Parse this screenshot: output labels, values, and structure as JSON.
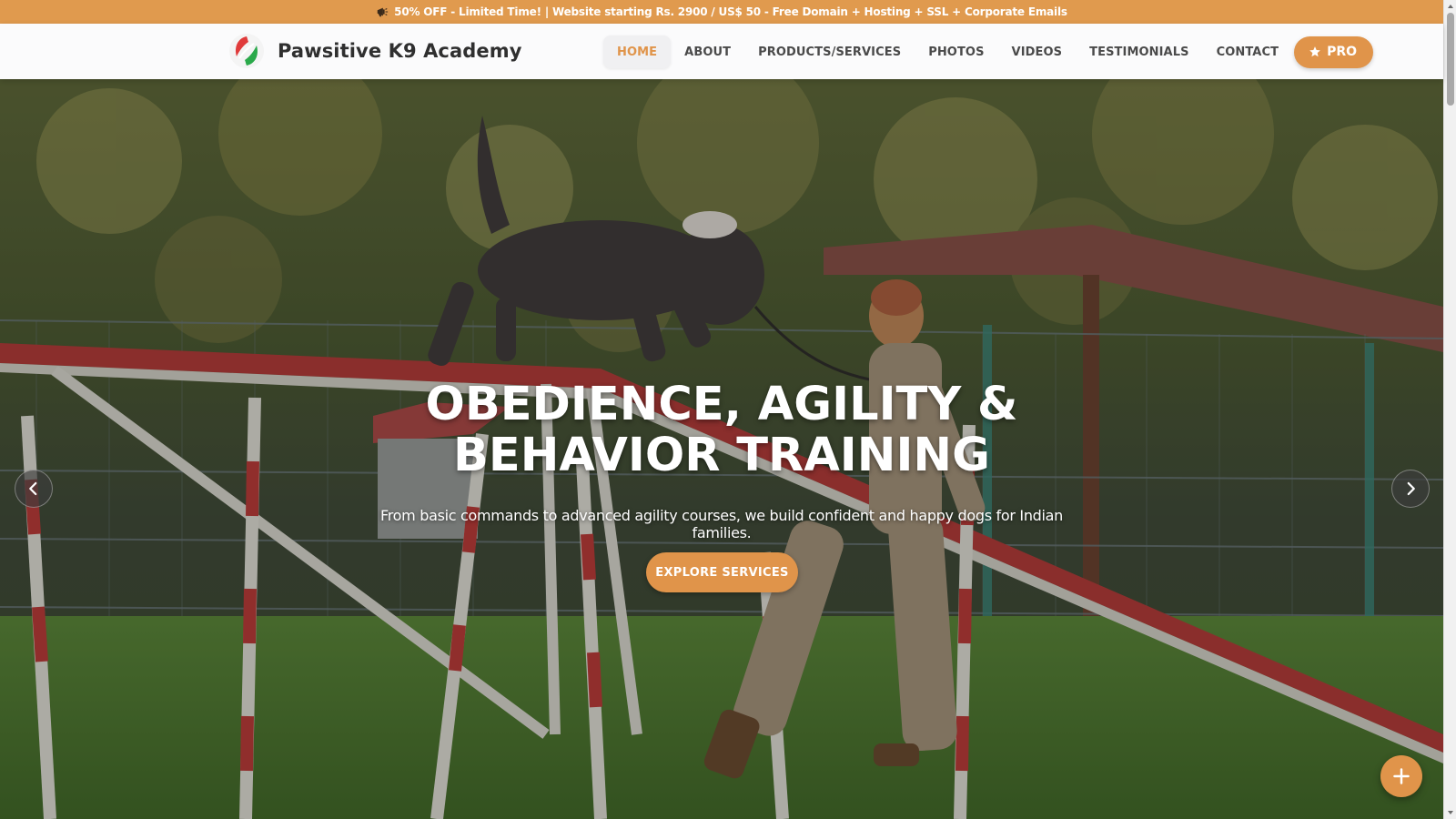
{
  "promo": {
    "icon": "megaphone-icon",
    "text": "50% OFF - Limited Time! | Website starting Rs. 2900 / US$ 50 - Free Domain + Hosting + SSL + Corporate Emails"
  },
  "brand": {
    "name": "Pawsitive K9 Academy",
    "logo_icon": "leaf-logo-icon",
    "logo_colors": [
      "#e03b3b",
      "#2aa94a"
    ]
  },
  "nav": {
    "items": [
      {
        "label": "HOME",
        "active": true
      },
      {
        "label": "ABOUT",
        "active": false
      },
      {
        "label": "PRODUCTS/SERVICES",
        "active": false
      },
      {
        "label": "PHOTOS",
        "active": false
      },
      {
        "label": "VIDEOS",
        "active": false
      },
      {
        "label": "TESTIMONIALS",
        "active": false
      },
      {
        "label": "CONTACT",
        "active": false
      }
    ],
    "pro_label": "PRO",
    "pro_icon": "star-icon"
  },
  "hero": {
    "title_line1": "OBEDIENCE, AGILITY &",
    "title_line2": "BEHAVIOR TRAINING",
    "subtitle": "From basic commands to advanced agility courses, we build confident and happy dogs for Indian families.",
    "cta_label": "EXPLORE SERVICES",
    "prev_icon": "chevron-left-icon",
    "next_icon": "chevron-right-icon",
    "image_description_icon": "hero-photo-dog-agility"
  },
  "fab": {
    "icon": "plus-icon"
  },
  "colors": {
    "accent": "#e0944a",
    "promo_bg": "#e09a4e",
    "header_bg": "#fbfbfc",
    "text_dark": "#2f2f2f"
  }
}
